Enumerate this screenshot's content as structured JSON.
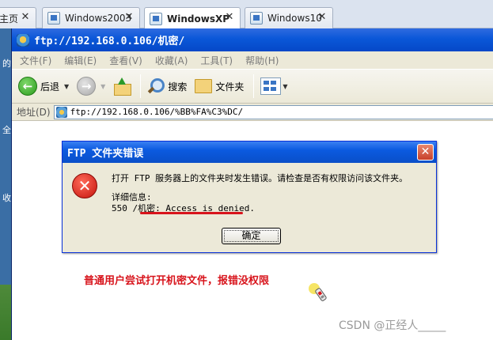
{
  "vm_tabs": {
    "partial_label": "主页",
    "items": [
      {
        "label": "Windows2003"
      },
      {
        "label": "WindowsXP"
      },
      {
        "label": "Windows10"
      }
    ]
  },
  "desktop": {
    "icons": [
      "的",
      "全",
      "收"
    ]
  },
  "ie_window": {
    "title": "ftp://192.168.0.106/机密/",
    "menu": [
      "文件(F)",
      "编辑(E)",
      "查看(V)",
      "收藏(A)",
      "工具(T)",
      "帮助(H)"
    ],
    "toolbar": {
      "back_label": "后退",
      "search_label": "搜索",
      "folders_label": "文件夹"
    },
    "address": {
      "label": "地址(D)",
      "value": "ftp://192.168.0.106/%BB%FA%C3%DC/"
    }
  },
  "error_dialog": {
    "title": "FTP 文件夹错误",
    "message": "打开 FTP 服务器上的文件夹时发生错误。请检查是否有权限访问该文件夹。",
    "detail_label": "详细信息:",
    "detail": "550 /机密: Access is denied.",
    "ok_label": "确定"
  },
  "annotation": "普通用户尝试打开机密文件，报错没权限",
  "watermark": "CSDN @正经人_____",
  "colors": {
    "annotation": "#d8141c",
    "xp_title_blue": "#0a57d8",
    "xp_chrome": "#ece9d8"
  }
}
